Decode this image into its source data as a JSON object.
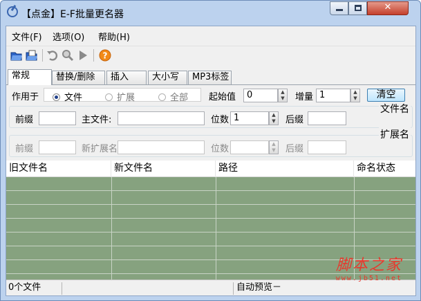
{
  "window": {
    "title": "【点金】E-F批量更名器",
    "controls": {
      "min": "",
      "max": "",
      "close": "✕"
    }
  },
  "menu": [
    {
      "label": "文件(F)",
      "name": "menu-file"
    },
    {
      "label": "选项(O)",
      "name": "menu-options"
    },
    {
      "label": "帮助(H)",
      "name": "menu-help"
    }
  ],
  "toolbar": {
    "icons": [
      "open-folder-icon",
      "open-files-icon",
      "undo-icon",
      "search-icon",
      "run-icon",
      "help-icon"
    ]
  },
  "tabs": [
    {
      "label": "常规",
      "active": true
    },
    {
      "label": "替换/删除",
      "active": false
    },
    {
      "label": "插入",
      "active": false
    },
    {
      "label": "大小写",
      "active": false
    },
    {
      "label": "MP3标签",
      "active": false
    }
  ],
  "general": {
    "apply_label": "作用于",
    "radios": [
      {
        "label": "文件",
        "selected": true,
        "disabled": false
      },
      {
        "label": "扩展",
        "selected": false,
        "disabled": true
      },
      {
        "label": "全部",
        "selected": false,
        "disabled": true
      }
    ],
    "start_label": "起始值",
    "start_value": "0",
    "step_label": "增量",
    "step_value": "1",
    "clear_label": "清空"
  },
  "filename_group": {
    "title": "文件名",
    "prefix_label": "前缀",
    "prefix_value": "",
    "newname_label": "主文件:",
    "newname_value": "",
    "digits_label": "位数",
    "digits_value": "1",
    "suffix_label": "后缀",
    "suffix_value": ""
  },
  "extension_group": {
    "title": "扩展名",
    "prefix_label": "前缀",
    "prefix_value": "",
    "newext_label": "新扩展名",
    "newext_value": "",
    "digits_label": "位数",
    "digits_value": "",
    "suffix_label": "后缀",
    "suffix_value": ""
  },
  "list": {
    "columns": [
      "旧文件名",
      "新文件名",
      "路径",
      "命名状态"
    ],
    "rows": []
  },
  "status": {
    "count": "0个文件",
    "preview": "自动预览－"
  },
  "watermark": {
    "text": "脚本之家",
    "url": "www.jb51.net"
  },
  "colors": {
    "list_bg": "#86a27f",
    "title_bar": "#bcd2ee",
    "close_button": "#c4402b",
    "clear_button": "#bee6fd"
  }
}
